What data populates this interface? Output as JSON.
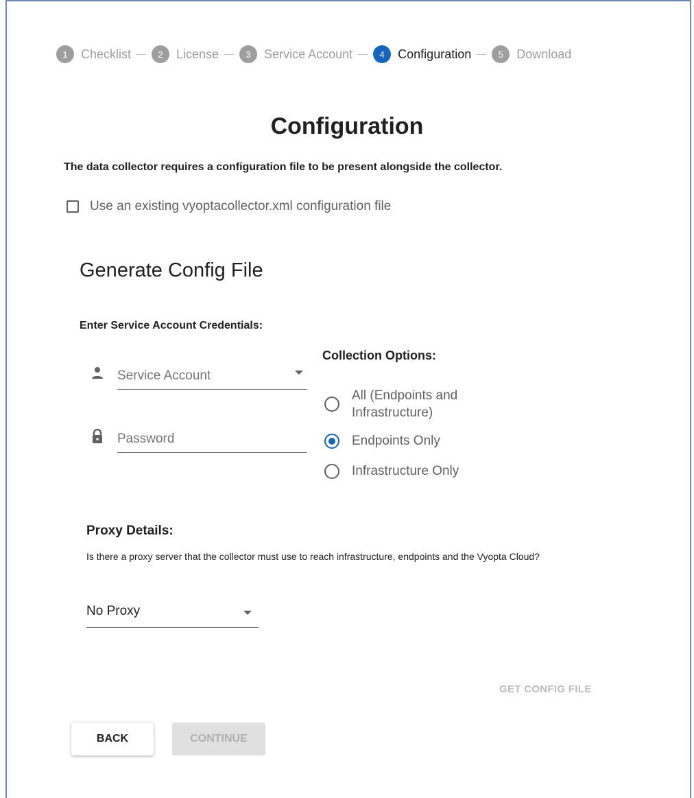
{
  "stepper": {
    "steps": [
      {
        "number": "1",
        "label": "Checklist"
      },
      {
        "number": "2",
        "label": "License"
      },
      {
        "number": "3",
        "label": "Service Account"
      },
      {
        "number": "4",
        "label": "Configuration"
      },
      {
        "number": "5",
        "label": "Download"
      }
    ],
    "active_color": "#1565c0",
    "inactive_color": "#9e9e9e"
  },
  "page": {
    "title": "Configuration",
    "intro": "The data collector requires a configuration file to be present alongside the collector."
  },
  "existing_config": {
    "label": "Use an existing vyoptacollector.xml configuration file",
    "checked": false
  },
  "generate": {
    "title": "Generate Config File",
    "credentials_label": "Enter Service Account Credentials:",
    "service_account": {
      "placeholder": "Service Account",
      "icon": "person-icon"
    },
    "password": {
      "placeholder": "Password",
      "icon": "lock-icon"
    }
  },
  "collection": {
    "title": "Collection Options:",
    "options": [
      {
        "label_line1": "All (Endpoints and",
        "label_line2": "Infrastructure)",
        "selected": false
      },
      {
        "label": "Endpoints Only",
        "selected": true
      },
      {
        "label": "Infrastructure Only",
        "selected": false
      }
    ]
  },
  "proxy": {
    "title": "Proxy Details:",
    "description": "Is there a proxy server that the collector must use to reach infrastructure, endpoints and the Vyopta Cloud?",
    "selected": "No Proxy"
  },
  "actions": {
    "get_config": "GET CONFIG FILE",
    "back": "BACK",
    "continue": "CONTINUE"
  }
}
